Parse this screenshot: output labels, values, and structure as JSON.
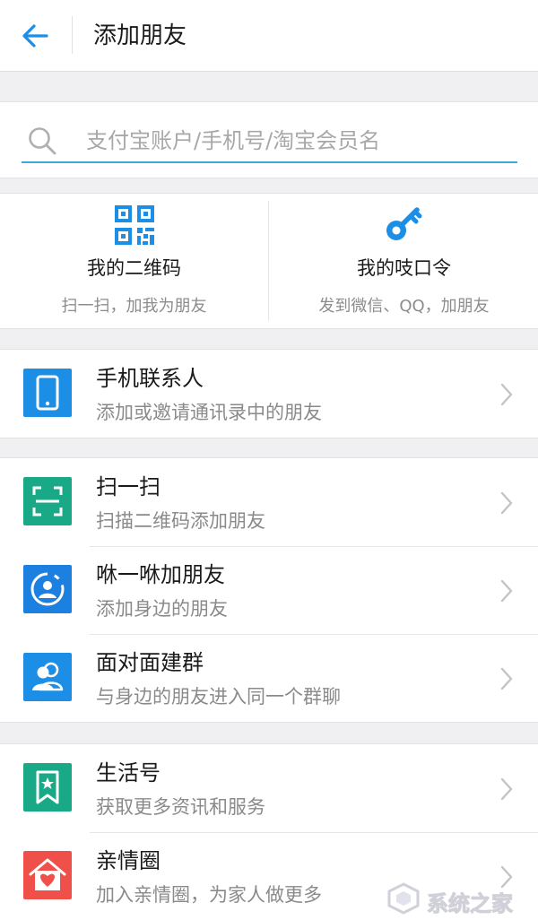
{
  "header": {
    "title": "添加朋友",
    "back_icon": "back-arrow-icon"
  },
  "search": {
    "placeholder": "支付宝账户/手机号/淘宝会员名",
    "icon": "search-icon"
  },
  "quick_actions": [
    {
      "title": "我的二维码",
      "subtitle": "扫一扫，加我为朋友",
      "icon": "qr-code-icon"
    },
    {
      "title": "我的吱口令",
      "subtitle": "发到微信、QQ，加朋友",
      "icon": "key-icon"
    }
  ],
  "groups": [
    {
      "items": [
        {
          "title": "手机联系人",
          "subtitle": "添加或邀请通讯录中的朋友",
          "icon": "phone-icon",
          "color": "#1c8ee6"
        }
      ]
    },
    {
      "items": [
        {
          "title": "扫一扫",
          "subtitle": "扫描二维码添加朋友",
          "icon": "scan-icon",
          "color": "#1aa987"
        },
        {
          "title": "咻一咻加朋友",
          "subtitle": "添加身边的朋友",
          "icon": "radar-person-icon",
          "color": "#1c80e0"
        },
        {
          "title": "面对面建群",
          "subtitle": "与身边的朋友进入同一个群聊",
          "icon": "group-people-icon",
          "color": "#1c8ee6"
        }
      ]
    },
    {
      "items": [
        {
          "title": "生活号",
          "subtitle": "获取更多资讯和服务",
          "icon": "bookmark-star-icon",
          "color": "#1aa987"
        },
        {
          "title": "亲情圈",
          "subtitle": "加入亲情圈，为家人做更多",
          "icon": "heart-home-icon",
          "color": "#f0504a"
        }
      ]
    }
  ],
  "watermark": {
    "text": "系统之家"
  },
  "colors": {
    "accent": "#1c8ee6",
    "search_underline": "#3aa8d8",
    "background": "#f0f0f2"
  }
}
